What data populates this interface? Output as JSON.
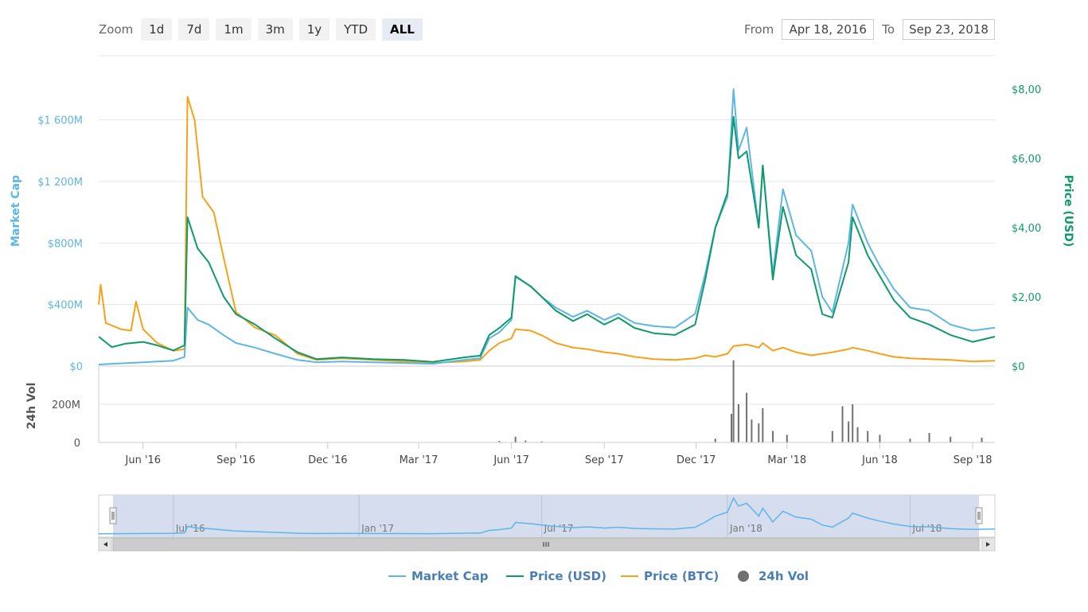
{
  "toolbar": {
    "zoom_label": "Zoom",
    "buttons": [
      {
        "label": "1d",
        "active": false
      },
      {
        "label": "7d",
        "active": false
      },
      {
        "label": "1m",
        "active": false
      },
      {
        "label": "3m",
        "active": false
      },
      {
        "label": "1y",
        "active": false
      },
      {
        "label": "YTD",
        "active": false
      },
      {
        "label": "ALL",
        "active": true
      }
    ],
    "from_label": "From",
    "from_value": "Apr 18, 2016",
    "to_label": "To",
    "to_value": "Sep 23, 2018"
  },
  "colors": {
    "market_cap": "#5db6e6",
    "price_usd": "#0f9a6b",
    "price_btc": "#f7a11a",
    "volume": "#707070",
    "left_axis_text": "#5db6e6",
    "right_axis_text": "#0f9a6b",
    "navigator_fill": "#d3dbee"
  },
  "chart_data": {
    "type": "line",
    "x_range": [
      "2016-04-18",
      "2018-09-23"
    ],
    "y_left": {
      "label": "Market Cap",
      "ticks": [
        0,
        400,
        800,
        1200,
        1600
      ],
      "tick_labels": [
        "$0",
        "$400M",
        "$800M",
        "$1 600M",
        "$1 200M"
      ],
      "range": [
        0,
        1800
      ]
    },
    "y_right": {
      "label": "Price (USD)",
      "ticks": [
        0,
        2,
        4,
        6,
        8
      ],
      "tick_labels": [
        "$0",
        "$2,00",
        "$4,00",
        "$6,00",
        "$8,00"
      ],
      "range": [
        0,
        8
      ]
    },
    "y_volume": {
      "label": "24h Vol",
      "ticks": [
        0,
        200
      ],
      "tick_labels": [
        "0",
        "200M"
      ],
      "range": [
        0,
        400
      ]
    },
    "x_ticks": [
      {
        "date": "2016-06-01",
        "label": "Jun '16"
      },
      {
        "date": "2016-09-01",
        "label": "Sep '16"
      },
      {
        "date": "2016-12-01",
        "label": "Dec '16"
      },
      {
        "date": "2017-03-01",
        "label": "Mar '17"
      },
      {
        "date": "2017-06-01",
        "label": "Jun '17"
      },
      {
        "date": "2017-09-01",
        "label": "Sep '17"
      },
      {
        "date": "2017-12-01",
        "label": "Dec '17"
      },
      {
        "date": "2018-03-01",
        "label": "Mar '18"
      },
      {
        "date": "2018-06-01",
        "label": "Jun '18"
      },
      {
        "date": "2018-09-01",
        "label": "Sep '18"
      }
    ],
    "navigator_ticks": [
      {
        "date": "2016-07-01",
        "label": "Jul '16"
      },
      {
        "date": "2017-01-01",
        "label": "Jan '17"
      },
      {
        "date": "2017-07-01",
        "label": "Jul '17"
      },
      {
        "date": "2018-01-01",
        "label": "Jan '18"
      },
      {
        "date": "2018-07-01",
        "label": "Jul '18"
      }
    ],
    "series": [
      {
        "name": "Market Cap",
        "axis": "left",
        "points": [
          [
            "2016-04-18",
            10
          ],
          [
            "2016-05-01",
            15
          ],
          [
            "2016-06-01",
            25
          ],
          [
            "2016-06-15",
            30
          ],
          [
            "2016-07-01",
            35
          ],
          [
            "2016-07-12",
            60
          ],
          [
            "2016-07-15",
            380
          ],
          [
            "2016-07-25",
            300
          ],
          [
            "2016-08-05",
            270
          ],
          [
            "2016-08-20",
            200
          ],
          [
            "2016-09-01",
            150
          ],
          [
            "2016-09-20",
            120
          ],
          [
            "2016-10-10",
            80
          ],
          [
            "2016-11-01",
            40
          ],
          [
            "2016-11-20",
            25
          ],
          [
            "2016-12-15",
            30
          ],
          [
            "2017-01-15",
            25
          ],
          [
            "2017-02-15",
            20
          ],
          [
            "2017-03-15",
            15
          ],
          [
            "2017-04-15",
            40
          ],
          [
            "2017-05-01",
            50
          ],
          [
            "2017-05-10",
            180
          ],
          [
            "2017-05-20",
            220
          ],
          [
            "2017-06-01",
            300
          ],
          [
            "2017-06-05",
            580
          ],
          [
            "2017-06-20",
            520
          ],
          [
            "2017-07-01",
            450
          ],
          [
            "2017-07-15",
            380
          ],
          [
            "2017-08-01",
            320
          ],
          [
            "2017-08-15",
            360
          ],
          [
            "2017-09-01",
            300
          ],
          [
            "2017-09-15",
            340
          ],
          [
            "2017-10-01",
            280
          ],
          [
            "2017-10-20",
            260
          ],
          [
            "2017-11-10",
            250
          ],
          [
            "2017-11-30",
            340
          ],
          [
            "2017-12-10",
            600
          ],
          [
            "2017-12-20",
            900
          ],
          [
            "2018-01-01",
            1100
          ],
          [
            "2018-01-07",
            1800
          ],
          [
            "2018-01-12",
            1400
          ],
          [
            "2018-01-20",
            1550
          ],
          [
            "2018-02-01",
            900
          ],
          [
            "2018-02-05",
            1300
          ],
          [
            "2018-02-15",
            600
          ],
          [
            "2018-02-25",
            1150
          ],
          [
            "2018-03-10",
            850
          ],
          [
            "2018-03-25",
            750
          ],
          [
            "2018-04-05",
            450
          ],
          [
            "2018-04-15",
            350
          ],
          [
            "2018-05-01",
            800
          ],
          [
            "2018-05-05",
            1050
          ],
          [
            "2018-05-20",
            800
          ],
          [
            "2018-06-01",
            650
          ],
          [
            "2018-06-15",
            500
          ],
          [
            "2018-07-01",
            380
          ],
          [
            "2018-07-20",
            360
          ],
          [
            "2018-08-10",
            270
          ],
          [
            "2018-09-01",
            230
          ],
          [
            "2018-09-23",
            250
          ]
        ]
      },
      {
        "name": "Price (USD)",
        "axis": "right",
        "points": [
          [
            "2016-04-18",
            0.85
          ],
          [
            "2016-05-01",
            0.55
          ],
          [
            "2016-05-15",
            0.65
          ],
          [
            "2016-06-01",
            0.7
          ],
          [
            "2016-06-15",
            0.6
          ],
          [
            "2016-07-01",
            0.45
          ],
          [
            "2016-07-12",
            0.6
          ],
          [
            "2016-07-15",
            4.3
          ],
          [
            "2016-07-25",
            3.4
          ],
          [
            "2016-08-05",
            3.0
          ],
          [
            "2016-08-20",
            2.0
          ],
          [
            "2016-09-01",
            1.5
          ],
          [
            "2016-09-20",
            1.2
          ],
          [
            "2016-10-10",
            0.8
          ],
          [
            "2016-11-01",
            0.4
          ],
          [
            "2016-11-20",
            0.2
          ],
          [
            "2016-12-15",
            0.25
          ],
          [
            "2017-01-15",
            0.2
          ],
          [
            "2017-02-15",
            0.18
          ],
          [
            "2017-03-15",
            0.12
          ],
          [
            "2017-04-15",
            0.25
          ],
          [
            "2017-05-01",
            0.3
          ],
          [
            "2017-05-10",
            0.9
          ],
          [
            "2017-05-20",
            1.1
          ],
          [
            "2017-06-01",
            1.4
          ],
          [
            "2017-06-05",
            2.6
          ],
          [
            "2017-06-20",
            2.3
          ],
          [
            "2017-07-01",
            2.0
          ],
          [
            "2017-07-15",
            1.6
          ],
          [
            "2017-08-01",
            1.3
          ],
          [
            "2017-08-15",
            1.5
          ],
          [
            "2017-09-01",
            1.2
          ],
          [
            "2017-09-15",
            1.4
          ],
          [
            "2017-10-01",
            1.1
          ],
          [
            "2017-10-20",
            0.95
          ],
          [
            "2017-11-10",
            0.9
          ],
          [
            "2017-11-30",
            1.2
          ],
          [
            "2017-12-10",
            2.5
          ],
          [
            "2017-12-20",
            4.0
          ],
          [
            "2018-01-01",
            5.0
          ],
          [
            "2018-01-07",
            7.2
          ],
          [
            "2018-01-12",
            6.0
          ],
          [
            "2018-01-20",
            6.2
          ],
          [
            "2018-02-01",
            4.0
          ],
          [
            "2018-02-05",
            5.8
          ],
          [
            "2018-02-15",
            2.5
          ],
          [
            "2018-02-25",
            4.6
          ],
          [
            "2018-03-10",
            3.2
          ],
          [
            "2018-03-25",
            2.8
          ],
          [
            "2018-04-05",
            1.5
          ],
          [
            "2018-04-15",
            1.4
          ],
          [
            "2018-05-01",
            3.0
          ],
          [
            "2018-05-05",
            4.3
          ],
          [
            "2018-05-20",
            3.2
          ],
          [
            "2018-06-01",
            2.6
          ],
          [
            "2018-06-15",
            1.9
          ],
          [
            "2018-07-01",
            1.4
          ],
          [
            "2018-07-20",
            1.2
          ],
          [
            "2018-08-10",
            0.9
          ],
          [
            "2018-09-01",
            0.7
          ],
          [
            "2018-09-23",
            0.85
          ]
        ]
      },
      {
        "name": "Price (BTC)",
        "axis": "left",
        "points": [
          [
            "2016-04-18",
            400
          ],
          [
            "2016-04-20",
            530
          ],
          [
            "2016-04-25",
            280
          ],
          [
            "2016-05-10",
            240
          ],
          [
            "2016-05-20",
            230
          ],
          [
            "2016-05-25",
            420
          ],
          [
            "2016-06-01",
            240
          ],
          [
            "2016-06-15",
            150
          ],
          [
            "2016-07-01",
            100
          ],
          [
            "2016-07-12",
            110
          ],
          [
            "2016-07-15",
            1750
          ],
          [
            "2016-07-22",
            1600
          ],
          [
            "2016-07-30",
            1100
          ],
          [
            "2016-08-10",
            1000
          ],
          [
            "2016-08-20",
            700
          ],
          [
            "2016-09-01",
            350
          ],
          [
            "2016-09-20",
            250
          ],
          [
            "2016-10-10",
            200
          ],
          [
            "2016-11-01",
            80
          ],
          [
            "2016-11-20",
            40
          ],
          [
            "2016-12-15",
            50
          ],
          [
            "2017-01-15",
            40
          ],
          [
            "2017-02-15",
            30
          ],
          [
            "2017-03-15",
            20
          ],
          [
            "2017-04-15",
            30
          ],
          [
            "2017-05-01",
            40
          ],
          [
            "2017-05-10",
            100
          ],
          [
            "2017-05-20",
            150
          ],
          [
            "2017-06-01",
            180
          ],
          [
            "2017-06-05",
            240
          ],
          [
            "2017-06-20",
            230
          ],
          [
            "2017-07-01",
            200
          ],
          [
            "2017-07-15",
            150
          ],
          [
            "2017-08-01",
            120
          ],
          [
            "2017-08-15",
            110
          ],
          [
            "2017-09-01",
            90
          ],
          [
            "2017-09-15",
            80
          ],
          [
            "2017-10-01",
            60
          ],
          [
            "2017-10-20",
            45
          ],
          [
            "2017-11-10",
            40
          ],
          [
            "2017-11-30",
            50
          ],
          [
            "2017-12-10",
            70
          ],
          [
            "2017-12-20",
            60
          ],
          [
            "2018-01-01",
            80
          ],
          [
            "2018-01-07",
            130
          ],
          [
            "2018-01-20",
            140
          ],
          [
            "2018-02-01",
            120
          ],
          [
            "2018-02-05",
            150
          ],
          [
            "2018-02-15",
            100
          ],
          [
            "2018-02-25",
            120
          ],
          [
            "2018-03-10",
            90
          ],
          [
            "2018-03-25",
            70
          ],
          [
            "2018-04-05",
            80
          ],
          [
            "2018-04-15",
            90
          ],
          [
            "2018-05-01",
            110
          ],
          [
            "2018-05-05",
            120
          ],
          [
            "2018-05-20",
            100
          ],
          [
            "2018-06-01",
            80
          ],
          [
            "2018-06-15",
            60
          ],
          [
            "2018-07-01",
            50
          ],
          [
            "2018-07-20",
            45
          ],
          [
            "2018-08-10",
            40
          ],
          [
            "2018-09-01",
            30
          ],
          [
            "2018-09-23",
            35
          ]
        ]
      },
      {
        "name": "24h Vol",
        "axis": "volume",
        "type": "bar",
        "points": [
          [
            "2017-05-20",
            8
          ],
          [
            "2017-06-05",
            30
          ],
          [
            "2017-06-15",
            10
          ],
          [
            "2017-07-01",
            5
          ],
          [
            "2017-12-20",
            20
          ],
          [
            "2018-01-05",
            150
          ],
          [
            "2018-01-07",
            430
          ],
          [
            "2018-01-12",
            200
          ],
          [
            "2018-01-20",
            260
          ],
          [
            "2018-01-25",
            120
          ],
          [
            "2018-02-01",
            100
          ],
          [
            "2018-02-05",
            180
          ],
          [
            "2018-02-15",
            60
          ],
          [
            "2018-03-01",
            40
          ],
          [
            "2018-04-15",
            60
          ],
          [
            "2018-04-25",
            190
          ],
          [
            "2018-05-01",
            110
          ],
          [
            "2018-05-05",
            200
          ],
          [
            "2018-05-10",
            80
          ],
          [
            "2018-05-20",
            60
          ],
          [
            "2018-06-01",
            40
          ],
          [
            "2018-07-01",
            20
          ],
          [
            "2018-07-20",
            50
          ],
          [
            "2018-08-10",
            30
          ],
          [
            "2018-09-10",
            25
          ]
        ]
      }
    ],
    "legend": {
      "position": "bottom",
      "items": [
        "Market Cap",
        "Price (USD)",
        "Price (BTC)",
        "24h Vol"
      ]
    },
    "grid": true
  }
}
